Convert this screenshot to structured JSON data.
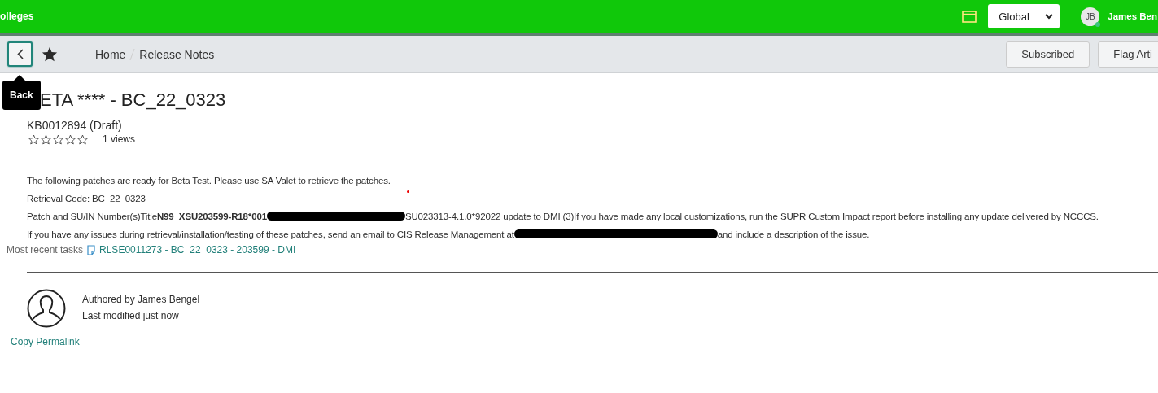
{
  "header": {
    "brand": "olleges",
    "scope": {
      "value": "Global"
    },
    "user": {
      "initials": "JB",
      "name": "James Ben"
    }
  },
  "toolbar": {
    "back_tooltip": "Back",
    "breadcrumbs": [
      "Home",
      "Release Notes"
    ],
    "buttons": [
      "Subscribed",
      "Flag Arti"
    ]
  },
  "article": {
    "title": "ETA **** - BC_22_0323",
    "number": "KB0012894 (Draft)",
    "stars": 0,
    "views": "1 views",
    "paragraphs": [
      {
        "parts": [
          {
            "kind": "text",
            "text": "The following patches are ready for Beta Test. Please use SA Valet to retrieve the patches."
          }
        ]
      },
      {
        "parts": [
          {
            "kind": "text",
            "text": "Retrieval Code: BC_22_0323"
          }
        ]
      },
      {
        "parts": [
          {
            "kind": "text",
            "text": "Patch and SU/IN Number(s)Title**N99_XSU203599-R18*001**"
          },
          {
            "kind": "redacted"
          },
          {
            "kind": "text",
            "text": "SU023313-4.1.0*92022 update to DMI (3)If you have made any local customizations, run the SUPR Custom Impact report before installing any update delivered by NCCCS."
          }
        ]
      },
      {
        "parts": [
          {
            "kind": "text",
            "text": "If you have any issues during retrieval/installation/testing of these patches, send an email to CIS Release Management at"
          },
          {
            "kind": "redacted"
          },
          {
            "kind": "text",
            "text": "and include a description of the issue."
          }
        ]
      }
    ],
    "tasks": {
      "label": "Most recent tasks",
      "link": "RLSE0011273 - BC_22_0323 - 203599 - DMI"
    },
    "author": "Authored by James Bengel",
    "modified": "Last modified just now",
    "permalink": "Copy Permalink"
  }
}
